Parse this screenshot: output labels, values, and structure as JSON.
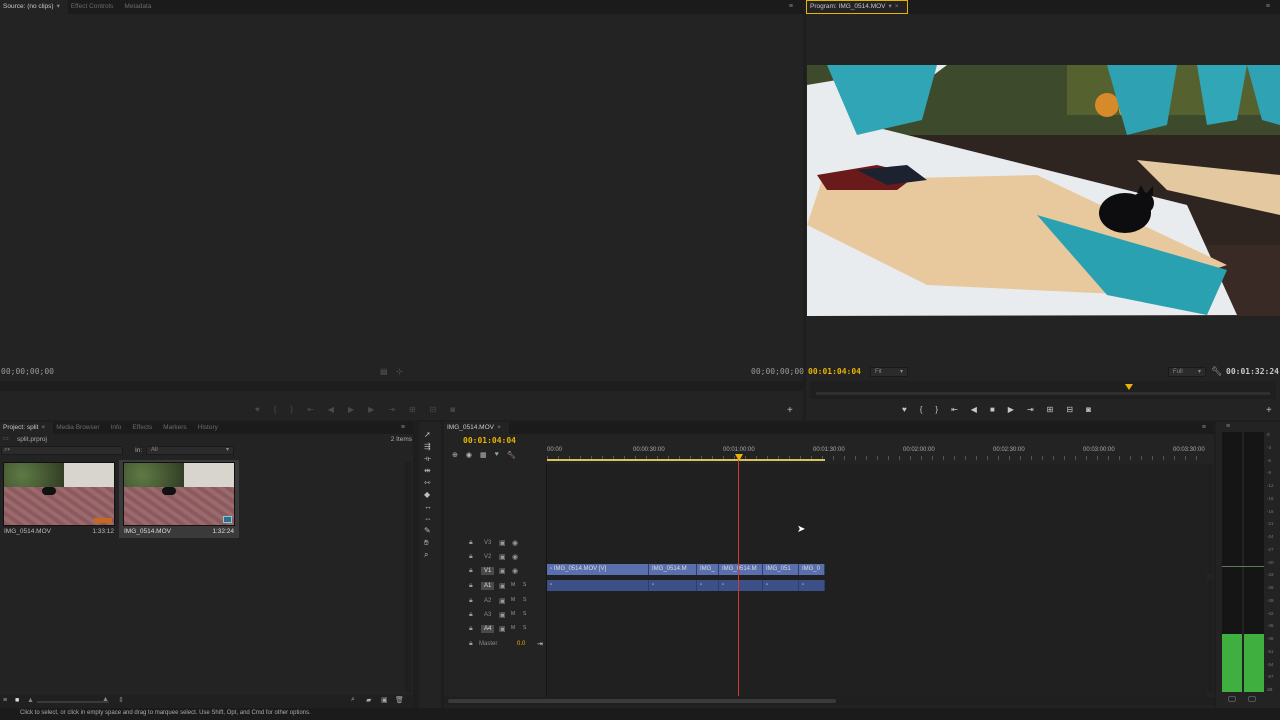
{
  "source": {
    "tabs": [
      {
        "label": "Source: (no clips)",
        "menu": "▾"
      },
      {
        "label": "Effect Controls"
      },
      {
        "label": "Metadata"
      }
    ],
    "timecode_in": "00;00;00;00",
    "timecode_out": "00;00;00;00"
  },
  "program": {
    "tab": "Program: IMG_0514.MOV",
    "timecode_current": "00:01:04:04",
    "zoom": "Fit",
    "resolution": "Full",
    "timecode_duration": "00:01:32:24",
    "playhead_fraction": 0.69
  },
  "project": {
    "tabs": [
      "Project: split",
      "Media Browser",
      "Info",
      "Effects",
      "Markers",
      "History"
    ],
    "filename": "split.prproj",
    "item_count": "2 Items",
    "in_label": "In:",
    "in_value": "All",
    "items": [
      {
        "name": "IMG_0514.MOV",
        "duration": "1:33:12"
      },
      {
        "name": "IMG_0514.MOV",
        "duration": "1:32:24"
      }
    ]
  },
  "timeline": {
    "tab": "IMG_0514.MOV",
    "timecode": "00:01:04:04",
    "ruler": [
      "00:00",
      "00:00:30:00",
      "00:01:00:00",
      "00:01:30:00",
      "00:02:00:00",
      "00:02:30:00",
      "00:03:00:00",
      "00:03:30:00"
    ],
    "video_tracks": [
      "V3",
      "V2",
      "V1"
    ],
    "audio_tracks": [
      "A1",
      "A2",
      "A3",
      "A4"
    ],
    "master_label": "Master",
    "master_value": "0.0",
    "video_clips": [
      "IMG_0514.MOV [V]",
      "IMG_0514.M",
      "IMG_",
      "IMG_0514.M",
      "IMG_051",
      "IMG_0"
    ]
  },
  "meter": {
    "ticks": [
      "0",
      "-3",
      "-6",
      "-9",
      "-12",
      "-15",
      "-18",
      "-21",
      "-24",
      "-27",
      "-30",
      "-33",
      "-36",
      "-39",
      "-42",
      "-45",
      "-48",
      "-51",
      "-54",
      "-57",
      "dB"
    ]
  },
  "status": {
    "hint": "Click to select, or click in empty space and drag to marquee select. Use Shift, Opt, and Cmd for other options."
  },
  "colors": {
    "accent": "#e8b400",
    "playhead": "#d43a2a",
    "video_clip": "#5a6fae",
    "audio_clip": "#3c5087",
    "meter_green": "#3fb040"
  }
}
